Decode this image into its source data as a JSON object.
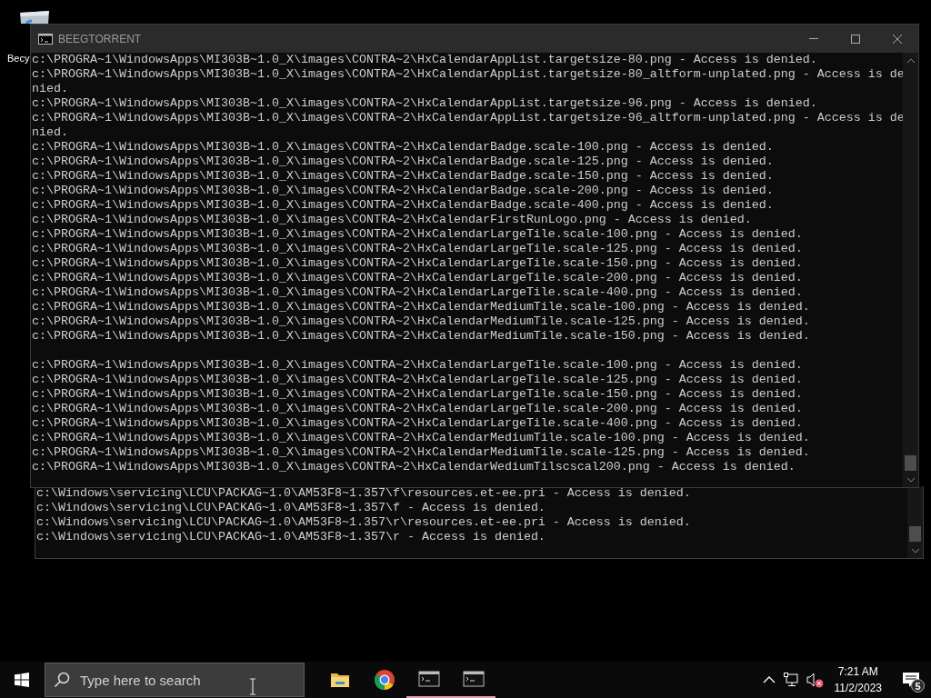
{
  "desktop": {
    "icons": [
      {
        "label": "Becy"
      }
    ]
  },
  "windows": [
    {
      "title": "BEEGTORRENT",
      "active": true,
      "blocks": [
        [
          "c:\\PROGRA~1\\WindowsApps\\MI303B~1.0_X\\images\\CONTRA~2\\HxCalendarAppList.targetsize-80.png - Access is denied.",
          "c:\\PROGRA~1\\WindowsApps\\MI303B~1.0_X\\images\\CONTRA~2\\HxCalendarAppList.targetsize-80_altform-unplated.png - Access is de",
          "nied.",
          "c:\\PROGRA~1\\WindowsApps\\MI303B~1.0_X\\images\\CONTRA~2\\HxCalendarAppList.targetsize-96.png - Access is denied.",
          "c:\\PROGRA~1\\WindowsApps\\MI303B~1.0_X\\images\\CONTRA~2\\HxCalendarAppList.targetsize-96_altform-unplated.png - Access is de",
          "nied.",
          "c:\\PROGRA~1\\WindowsApps\\MI303B~1.0_X\\images\\CONTRA~2\\HxCalendarBadge.scale-100.png - Access is denied.",
          "c:\\PROGRA~1\\WindowsApps\\MI303B~1.0_X\\images\\CONTRA~2\\HxCalendarBadge.scale-125.png - Access is denied.",
          "c:\\PROGRA~1\\WindowsApps\\MI303B~1.0_X\\images\\CONTRA~2\\HxCalendarBadge.scale-150.png - Access is denied.",
          "c:\\PROGRA~1\\WindowsApps\\MI303B~1.0_X\\images\\CONTRA~2\\HxCalendarBadge.scale-200.png - Access is denied.",
          "c:\\PROGRA~1\\WindowsApps\\MI303B~1.0_X\\images\\CONTRA~2\\HxCalendarBadge.scale-400.png - Access is denied.",
          "c:\\PROGRA~1\\WindowsApps\\MI303B~1.0_X\\images\\CONTRA~2\\HxCalendarFirstRunLogo.png - Access is denied.",
          "c:\\PROGRA~1\\WindowsApps\\MI303B~1.0_X\\images\\CONTRA~2\\HxCalendarLargeTile.scale-100.png - Access is denied.",
          "c:\\PROGRA~1\\WindowsApps\\MI303B~1.0_X\\images\\CONTRA~2\\HxCalendarLargeTile.scale-125.png - Access is denied.",
          "c:\\PROGRA~1\\WindowsApps\\MI303B~1.0_X\\images\\CONTRA~2\\HxCalendarLargeTile.scale-150.png - Access is denied.",
          "c:\\PROGRA~1\\WindowsApps\\MI303B~1.0_X\\images\\CONTRA~2\\HxCalendarLargeTile.scale-200.png - Access is denied.",
          "c:\\PROGRA~1\\WindowsApps\\MI303B~1.0_X\\images\\CONTRA~2\\HxCalendarLargeTile.scale-400.png - Access is denied.",
          "c:\\PROGRA~1\\WindowsApps\\MI303B~1.0_X\\images\\CONTRA~2\\HxCalendarMediumTile.scale-100.png - Access is denied.",
          "c:\\PROGRA~1\\WindowsApps\\MI303B~1.0_X\\images\\CONTRA~2\\HxCalendarMediumTile.scale-125.png - Access is denied.",
          "c:\\PROGRA~1\\WindowsApps\\MI303B~1.0_X\\images\\CONTRA~2\\HxCalendarMediumTile.scale-150.png - Access is denied."
        ],
        [
          "c:\\PROGRA~1\\WindowsApps\\MI303B~1.0_X\\images\\CONTRA~2\\HxCalendarLargeTile.scale-100.png - Access is denied.",
          "c:\\PROGRA~1\\WindowsApps\\MI303B~1.0_X\\images\\CONTRA~2\\HxCalendarLargeTile.scale-125.png - Access is denied.",
          "c:\\PROGRA~1\\WindowsApps\\MI303B~1.0_X\\images\\CONTRA~2\\HxCalendarLargeTile.scale-150.png - Access is denied.",
          "c:\\PROGRA~1\\WindowsApps\\MI303B~1.0_X\\images\\CONTRA~2\\HxCalendarLargeTile.scale-200.png - Access is denied.",
          "c:\\PROGRA~1\\WindowsApps\\MI303B~1.0_X\\images\\CONTRA~2\\HxCalendarLargeTile.scale-400.png - Access is denied.",
          "c:\\PROGRA~1\\WindowsApps\\MI303B~1.0_X\\images\\CONTRA~2\\HxCalendarMediumTile.scale-100.png - Access is denied.",
          "c:\\PROGRA~1\\WindowsApps\\MI303B~1.0_X\\images\\CONTRA~2\\HxCalendarMediumTile.scale-125.png - Access is denied.",
          "c:\\PROGRA~1\\WindowsApps\\MI303B~1.0_X\\images\\CONTRA~2\\HxCalendarWediumTilscscal200.png - Access is denied."
        ]
      ]
    },
    {
      "blocks": [
        [
          "c:\\Windows\\servicing\\LCU\\PACKAG~1.0\\AM53F8~1.357\\f\\resources.et-ee.pri - Access is denied.",
          "c:\\Windows\\servicing\\LCU\\PACKAG~1.0\\AM53F8~1.357\\f - Access is denied.",
          "c:\\Windows\\servicing\\LCU\\PACKAG~1.0\\AM53F8~1.357\\r\\resources.et-ee.pri - Access is denied.",
          "c:\\Windows\\servicing\\LCU\\PACKAG~1.0\\AM53F8~1.357\\r - Access is denied."
        ]
      ]
    }
  ],
  "taskbar": {
    "search": {
      "placeholder": "Type here to search"
    },
    "apps": [
      {
        "kind": "folder",
        "running": false
      },
      {
        "kind": "browser",
        "running": false
      },
      {
        "kind": "console",
        "running": true
      },
      {
        "kind": "console",
        "running": true
      }
    ],
    "tray": {
      "volume": {
        "muted": true
      }
    },
    "clock": {
      "time": "7:21 AM",
      "date": "11/2/2023"
    },
    "notifications": {
      "count": "5"
    }
  }
}
